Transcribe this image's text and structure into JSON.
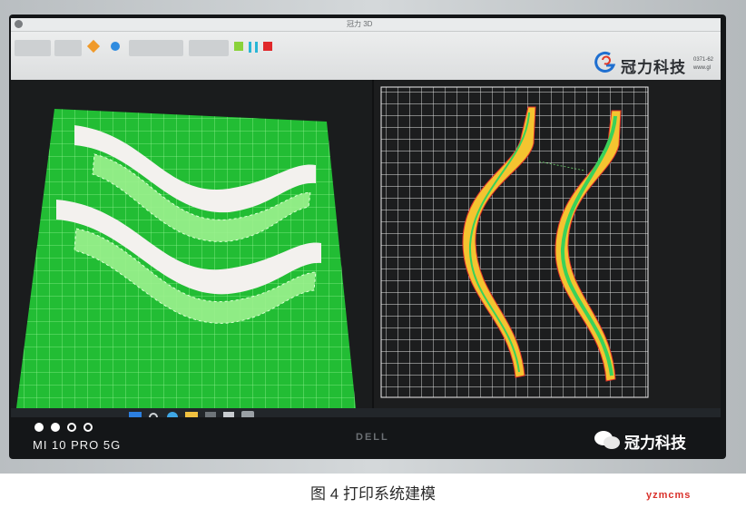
{
  "photo": {
    "screen": {
      "app_title": "冠力 3D",
      "brand": {
        "logo": "guanli-swirl-logo",
        "name": "冠力科技",
        "contact_line_1": "0371-62",
        "contact_line_2": "www.gl"
      },
      "left_view": "green 3D build plate with two printed curved railing parts",
      "right_view": "top-down slice layout with two S-curved yellow/green toolpaths on white grid"
    },
    "taskbar": {
      "icons": [
        "windows-icon",
        "search-icon",
        "edge-icon",
        "folder-icon",
        "store-icon",
        "mail-icon",
        "app-icon"
      ]
    },
    "monitor_brand": "DELL",
    "phone_watermark": "MI 10 PRO 5G",
    "wechat_watermark": {
      "icon": "wechat-icon",
      "text": "冠力科技"
    },
    "colors": {
      "plate_green": "#26c43a",
      "model_white": "#f2f2ee",
      "path_yellow": "#f4c430",
      "path_green": "#3ad15a",
      "grid_white": "#e6e6e6"
    }
  },
  "caption": {
    "text": "图 4 打印系统建模"
  },
  "site_watermark": "yzmcms"
}
